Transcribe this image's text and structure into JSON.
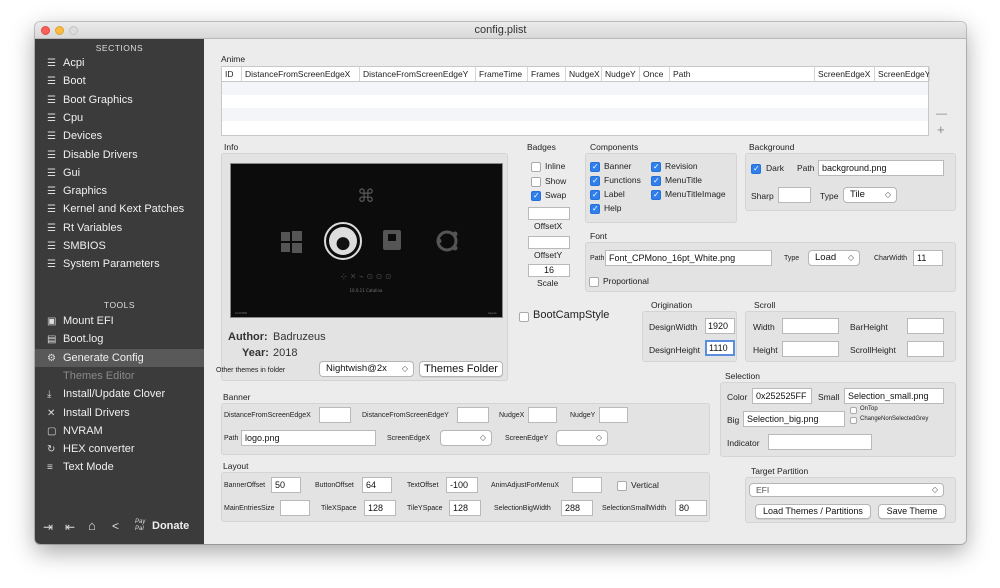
{
  "window": {
    "title": "config.plist"
  },
  "colors": {
    "sidebar_bg": "#3b3b3b",
    "accent": "#2f80ed",
    "close": "#fc605b",
    "minimize": "#fdbc40",
    "zoom": "#e0e0e0"
  },
  "sidebar": {
    "sections_header": "SECTIONS",
    "sections": [
      "Acpi",
      "Boot",
      "Boot Graphics",
      "Cpu",
      "Devices",
      "Disable Drivers",
      "Gui",
      "Graphics",
      "Kernel and Kext Patches",
      "Rt Variables",
      "SMBIOS",
      "System Parameters"
    ],
    "tools_header": "TOOLS",
    "tools": [
      {
        "label": "Mount EFI",
        "icon": "drive-icon"
      },
      {
        "label": "Boot.log",
        "icon": "log-icon"
      },
      {
        "label": "Generate Config",
        "icon": "gears-icon"
      },
      {
        "label": "Themes Editor",
        "icon": ""
      },
      {
        "label": "Install/Update Clover",
        "icon": "download-icon"
      },
      {
        "label": "Install Drivers",
        "icon": "tools-icon"
      },
      {
        "label": "NVRAM",
        "icon": "chip-icon"
      },
      {
        "label": "HEX converter",
        "icon": "refresh-icon"
      },
      {
        "label": "Text Mode",
        "icon": "lines-icon"
      }
    ],
    "selected": "Themes Editor",
    "donate": "Donate",
    "pay_pal": "Pay Pal"
  },
  "anime": {
    "title": "Anime",
    "columns": [
      "ID",
      "DistanceFromScreenEdgeX",
      "DistanceFromScreenEdgeY",
      "FrameTime",
      "Frames",
      "NudgeX",
      "NudgeY",
      "Once",
      "Path",
      "ScreenEdgeX",
      "ScreenEdgeY"
    ],
    "minus": "—",
    "plus": "+"
  },
  "info": {
    "title": "Info",
    "author_label": "Author:",
    "author": "Badruzeus",
    "year_label": "Year:",
    "year": "2018",
    "other_label": "Other themes in folder",
    "theme_selected": "Nightwish@2x",
    "themes_folder": "Themes Folder",
    "preview_foot_left": "CLOVER",
    "preview_foot_mid": "10.0.11 Catalina",
    "preview_foot_right": "Apple"
  },
  "badges": {
    "title": "Badges",
    "inline": {
      "label": "Inline",
      "checked": false
    },
    "show": {
      "label": "Show",
      "checked": false
    },
    "swap": {
      "label": "Swap",
      "checked": true
    },
    "offsetx_label": "OffsetX",
    "offsetx": "",
    "offsety_label": "OffsetY",
    "offsety": "",
    "scale_label": "Scale",
    "scale": "16"
  },
  "components": {
    "title": "Components",
    "items": [
      {
        "label": "Banner",
        "checked": true
      },
      {
        "label": "Revision",
        "checked": true
      },
      {
        "label": "Functions",
        "checked": true
      },
      {
        "label": "MenuTitle",
        "checked": true
      },
      {
        "label": "Label",
        "checked": true
      },
      {
        "label": "MenuTitleImage",
        "checked": true
      },
      {
        "label": "Help",
        "checked": true
      }
    ]
  },
  "background": {
    "title": "Background",
    "dark": {
      "label": "Dark",
      "checked": true
    },
    "path_label": "Path",
    "path": "background.png",
    "sharp_label": "Sharp",
    "sharp": "",
    "type_label": "Type",
    "type": "Tile"
  },
  "font": {
    "title": "Font",
    "path_label": "Path",
    "path": "Font_CPMono_16pt_White.png",
    "type_label": "Type",
    "type": "Load",
    "charwidth_label": "CharWidth",
    "charwidth": "11",
    "proportional": {
      "label": "Proportional",
      "checked": false
    }
  },
  "bootcamp": {
    "label": "BootCampStyle",
    "checked": false
  },
  "origination": {
    "title": "Origination",
    "width_label": "DesignWidth",
    "width": "1920",
    "height_label": "DesignHeight",
    "height": "1110"
  },
  "scroll": {
    "title": "Scroll",
    "width_label": "Width",
    "width": "",
    "barheight_label": "BarHeight",
    "barheight": "",
    "height_label": "Height",
    "height": "",
    "scrollheight_label": "ScrollHeight",
    "scrollheight": ""
  },
  "selection": {
    "title": "Selection",
    "color_label": "Color",
    "color": "0x252525FF",
    "small_label": "Small",
    "small": "Selection_small.png",
    "big_label": "Big",
    "big": "Selection_big.png",
    "ontop": {
      "label": "OnTop",
      "checked": false
    },
    "changegrey": {
      "label": "ChangeNonSelectedGrey",
      "checked": false
    },
    "indicator_label": "Indicator",
    "indicator": ""
  },
  "banner": {
    "title": "Banner",
    "dx_label": "DistanceFromScreenEdgeX",
    "dx": "",
    "dy_label": "DistanceFromScreenEdgeY",
    "dy": "",
    "nx_label": "NudgeX",
    "nx": "",
    "ny_label": "NudgeY",
    "ny": "",
    "path_label": "Path",
    "path": "logo.png",
    "sex_label": "ScreenEdgeX",
    "sex": "",
    "sey_label": "ScreenEdgeY",
    "sey": ""
  },
  "layout": {
    "title": "Layout",
    "banneroffset_label": "BannerOffset",
    "banneroffset": "50",
    "buttonoffset_label": "ButtonOffset",
    "buttonoffset": "64",
    "textoffset_label": "TextOffset",
    "textoffset": "-100",
    "animadjust_label": "AnimAdjustForMenuX",
    "animadjust": "",
    "vertical": {
      "label": "Vertical",
      "checked": false
    },
    "mainentries_label": "MainEntriesSize",
    "mainentries": "",
    "tilex_label": "TileXSpace",
    "tilex": "128",
    "tiley_label": "TileYSpace",
    "tiley": "128",
    "selbig_label": "SelectionBigWidth",
    "selbig": "288",
    "selsmall_label": "SelectionSmallWidth",
    "selsmall": "80"
  },
  "target": {
    "title": "Target Partition",
    "partition": "EFI",
    "load_button": "Load Themes / Partitions",
    "save_button": "Save Theme"
  }
}
